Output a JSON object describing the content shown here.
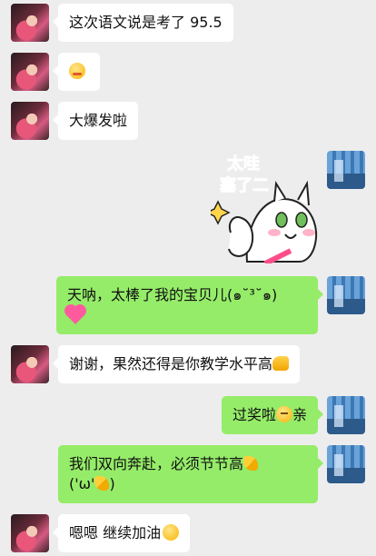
{
  "messages": [
    {
      "side": "left",
      "text": "这次语文说是考了 95.5"
    },
    {
      "side": "left",
      "emoji": "blush-face-emoji"
    },
    {
      "side": "left",
      "text": "大爆发啦"
    },
    {
      "side": "right",
      "sticker": {
        "text_line1": "太哇",
        "text_line2": "塞了二"
      }
    },
    {
      "side": "right",
      "text": "天呐，太棒了我的宝贝儿(๑˘³˘๑)",
      "emoji_after": "heart"
    },
    {
      "side": "left",
      "text": "谢谢，果然还得是你教学水平高",
      "emoji_after": "thumbs-up"
    },
    {
      "side": "right",
      "text_before": "过奖啦",
      "text_after": "亲",
      "emoji_mid": "smiling-face"
    },
    {
      "side": "right",
      "text_line1": "我们双向奔赴，必须节节高",
      "text_line2_a": "('ω'",
      "text_line2_b": ")"
    },
    {
      "side": "left",
      "text": "嗯嗯  继续加油"
    }
  ],
  "colors": {
    "background": "#ededed",
    "self_bubble": "#95ec69",
    "other_bubble": "#ffffff"
  }
}
